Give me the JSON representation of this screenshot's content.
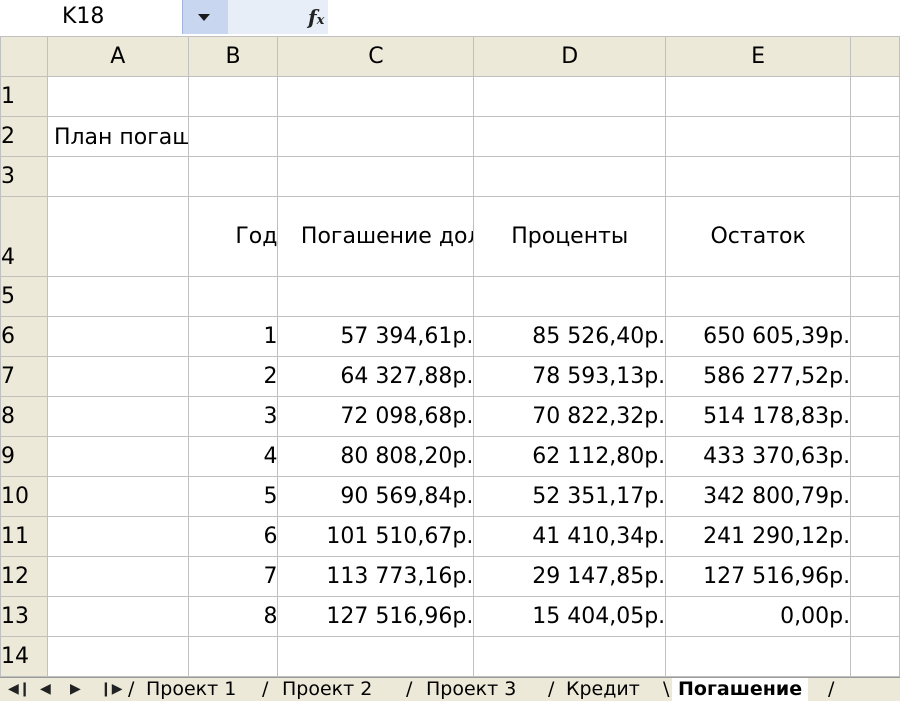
{
  "namebox": {
    "cell": "K18"
  },
  "formula_bar": {
    "fx_label": "fx",
    "value": ""
  },
  "columns": [
    "A",
    "B",
    "C",
    "D",
    "E"
  ],
  "rows": [
    "1",
    "2",
    "3",
    "4",
    "5",
    "6",
    "7",
    "8",
    "9",
    "10",
    "11",
    "12",
    "13",
    "14"
  ],
  "sheet": {
    "title": "План погашения",
    "headers": {
      "year": "Год",
      "debt": "Погашение долга",
      "interest": "Проценты",
      "balance": "Остаток"
    },
    "data": [
      {
        "year": "1",
        "debt": "57 394,61р.",
        "interest": "85 526,40р.",
        "balance": "650 605,39р."
      },
      {
        "year": "2",
        "debt": "64 327,88р.",
        "interest": "78 593,13р.",
        "balance": "586 277,52р."
      },
      {
        "year": "3",
        "debt": "72 098,68р.",
        "interest": "70 822,32р.",
        "balance": "514 178,83р."
      },
      {
        "year": "4",
        "debt": "80 808,20р.",
        "interest": "62 112,80р.",
        "balance": "433 370,63р."
      },
      {
        "year": "5",
        "debt": "90 569,84р.",
        "interest": "52 351,17р.",
        "balance": "342 800,79р."
      },
      {
        "year": "6",
        "debt": "101 510,67р.",
        "interest": "41 410,34р.",
        "balance": "241 290,12р."
      },
      {
        "year": "7",
        "debt": "113 773,16р.",
        "interest": "29 147,85р.",
        "balance": "127 516,96р."
      },
      {
        "year": "8",
        "debt": "127 516,96р.",
        "interest": "15 404,05р.",
        "balance": "0,00р."
      }
    ]
  },
  "tabs": [
    "Проект 1",
    "Проект 2",
    "Проект 3",
    "Кредит",
    "Погашение"
  ],
  "active_tab": "Погашение",
  "nav_icons": [
    "first-sheet-icon",
    "prev-sheet-icon",
    "next-sheet-icon",
    "last-sheet-icon"
  ],
  "colors": {
    "header_bg": "#ece9d8",
    "gridline": "#c0c0c0",
    "dropdown_bg": "#c8d6f0"
  }
}
